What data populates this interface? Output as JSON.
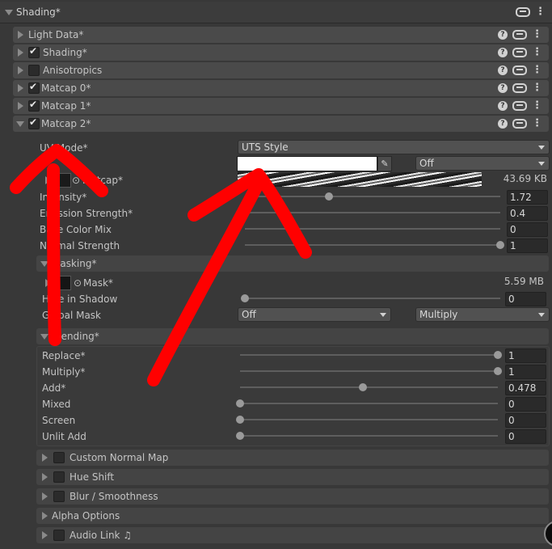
{
  "header": {
    "title": "Shading*"
  },
  "panels": [
    {
      "label": "Light Data*",
      "checkbox": null
    },
    {
      "label": "Shading*",
      "checkbox": true
    },
    {
      "label": "Anisotropics",
      "checkbox": false
    },
    {
      "label": "Matcap 0*",
      "checkbox": true
    },
    {
      "label": "Matcap 1*",
      "checkbox": true
    },
    {
      "label": "Matcap 2*",
      "checkbox": true
    }
  ],
  "matcap2": {
    "uv_mode_label": "UV Mode*",
    "uv_mode_value": "UTS Style",
    "color_value": "",
    "blend_mode_value": "Off",
    "matcap_label": "Matcap*",
    "matcap_size": "43.69 KB",
    "properties": [
      {
        "label": "Intensity*",
        "value": "1.72",
        "fraction": 0.33
      },
      {
        "label": "Emission Strength*",
        "value": "0.4",
        "fraction": null
      },
      {
        "label": "Base Color Mix",
        "value": "0",
        "fraction": null
      },
      {
        "label": "Normal Strength",
        "value": "1",
        "fraction": 1.0
      }
    ],
    "masking": {
      "title": "Masking*",
      "mask_label": "Mask*",
      "mask_size": "5.59 MB",
      "hide_shadow_label": "Hide in Shadow",
      "hide_shadow_value": "0",
      "hide_shadow_fraction": 0.0,
      "global_mask_label": "Global Mask",
      "global_mask_value": "Off",
      "global_mask_blend": "Multiply"
    },
    "blending": {
      "title": "Blending*",
      "rows": [
        {
          "label": "Replace*",
          "value": "1",
          "fraction": 1.0
        },
        {
          "label": "Multiply*",
          "value": "1",
          "fraction": 1.0
        },
        {
          "label": "Add*",
          "value": "0.478",
          "fraction": 0.478
        },
        {
          "label": "Mixed",
          "value": "0",
          "fraction": 0.0
        },
        {
          "label": "Screen",
          "value": "0",
          "fraction": 0.0
        },
        {
          "label": "Unlit Add",
          "value": "0",
          "fraction": 0.0
        }
      ]
    }
  },
  "sub_panels": [
    {
      "label": "Custom Normal Map",
      "checkbox": false
    },
    {
      "label": "Hue Shift",
      "checkbox": false
    },
    {
      "label": "Blur / Smoothness",
      "checkbox": false
    },
    {
      "label": "Alpha Options",
      "checkbox": null
    },
    {
      "label": "Audio Link ♫",
      "checkbox": false
    }
  ],
  "colors": {
    "annotation_red": "#ff0000",
    "panel_bg": "#4a4a4a",
    "window_bg": "#383838"
  }
}
